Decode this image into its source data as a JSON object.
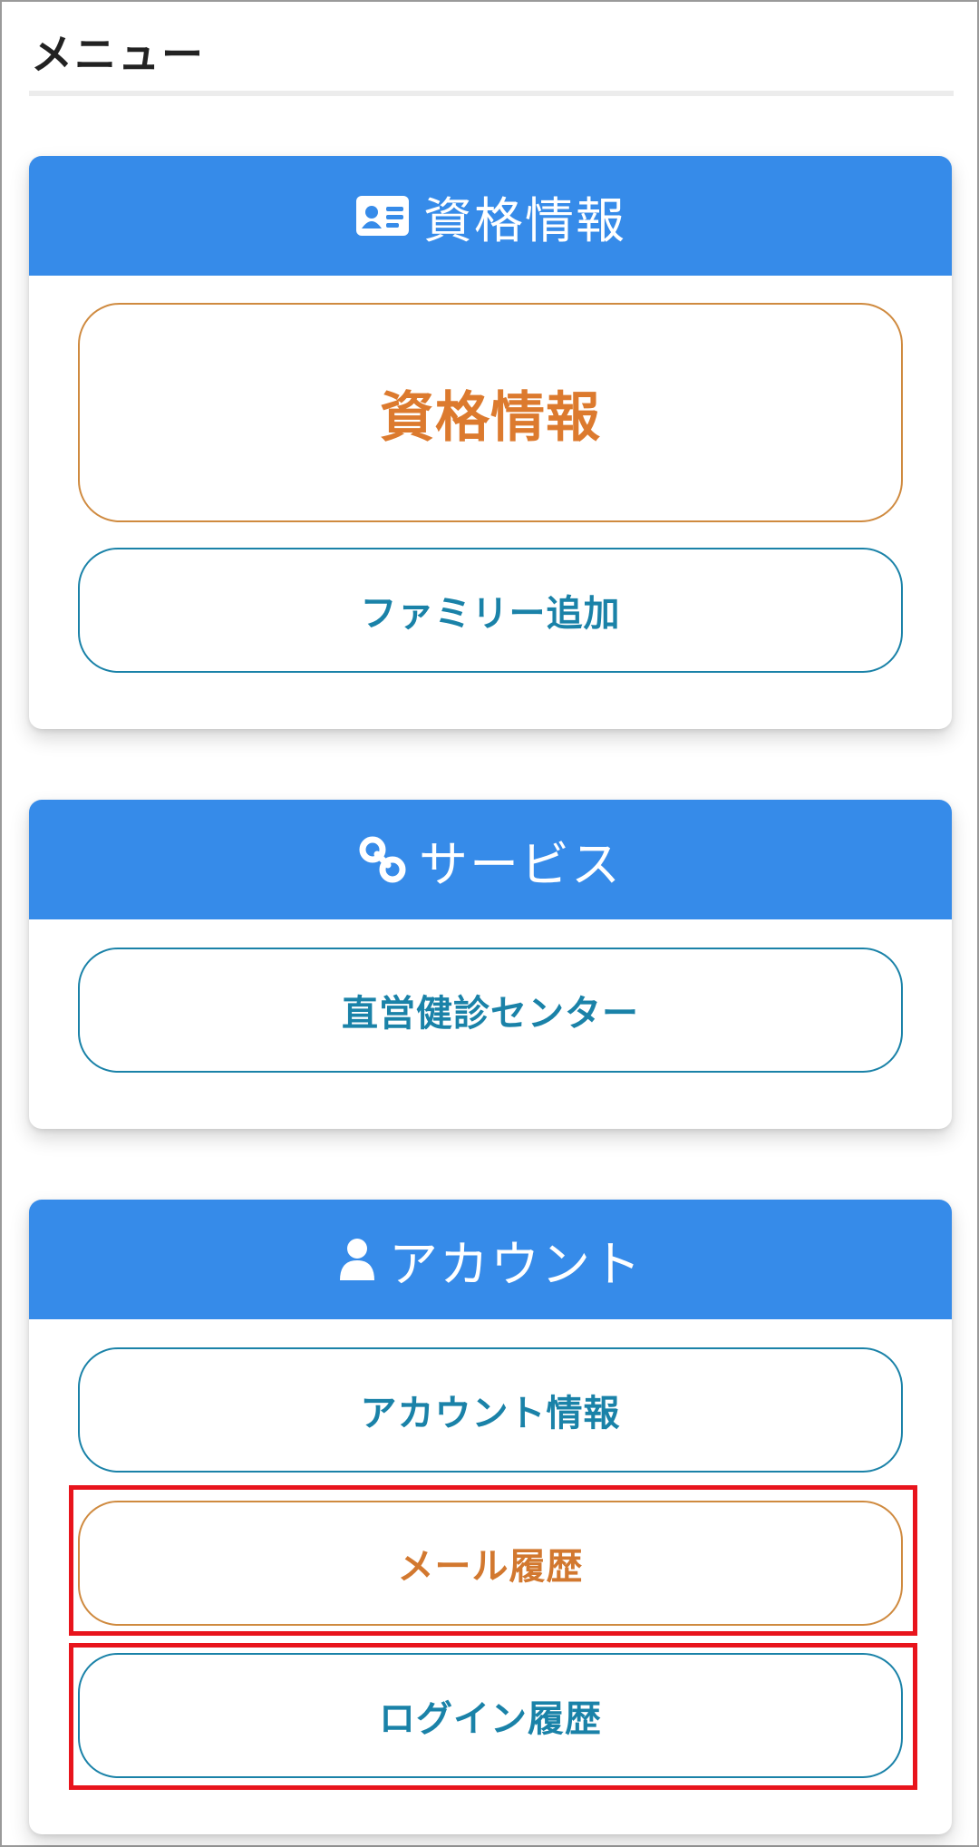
{
  "page": {
    "title": "メニュー"
  },
  "sections": [
    {
      "header": "資格情報",
      "icon": "id-card-icon",
      "buttons": [
        {
          "label": "資格情報"
        },
        {
          "label": "ファミリー追加"
        }
      ]
    },
    {
      "header": "サービス",
      "icon": "link-icon",
      "buttons": [
        {
          "label": "直営健診センター"
        }
      ]
    },
    {
      "header": "アカウント",
      "icon": "user-icon",
      "buttons": [
        {
          "label": "アカウント情報"
        },
        {
          "label": "メール履歴"
        },
        {
          "label": "ログイン履歴"
        }
      ]
    }
  ],
  "colors": {
    "header_blue": "#368be9",
    "button_teal": "#1a82a8",
    "button_orange": "#dc7a2e",
    "highlight_red": "#e8141c"
  }
}
